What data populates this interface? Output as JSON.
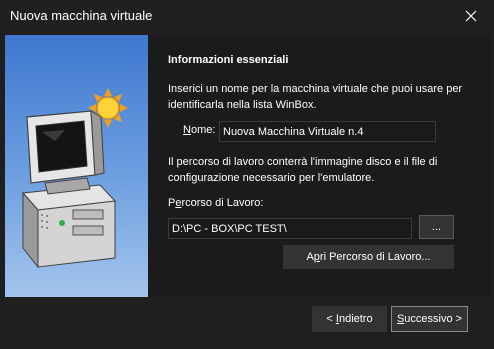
{
  "window": {
    "title": "Nuova macchina virtuale"
  },
  "heading": "Informazioni essenziali",
  "intro_text": "Inserici un nome per la macchina virtuale che puoi usare per identificarla nella lista WinBox.",
  "name": {
    "label_mnemonic": "N",
    "label_rest": "ome:",
    "value": "Nuova Macchina Virtuale n.4"
  },
  "path_info_text": "Il percorso di lavoro conterrà l'immagine disco e il file di configurazione necessario per l'emulatore.",
  "path": {
    "label_prefix": "P",
    "label_mnemonic": "e",
    "label_rest": "rcorso di Lavoro:",
    "value": "D:\\PC - BOX\\PC TEST\\"
  },
  "buttons": {
    "browse": "...",
    "open_prefix": "A",
    "open_mnemonic": "p",
    "open_rest": "ri Percorso di Lavoro...",
    "back_prefix": "< ",
    "back_mnemonic": "I",
    "back_rest": "ndietro",
    "next_mnemonic": "S",
    "next_rest": "uccessivo >"
  },
  "icons": {
    "close": "close-icon",
    "banner": "computer-with-sun-icon"
  }
}
